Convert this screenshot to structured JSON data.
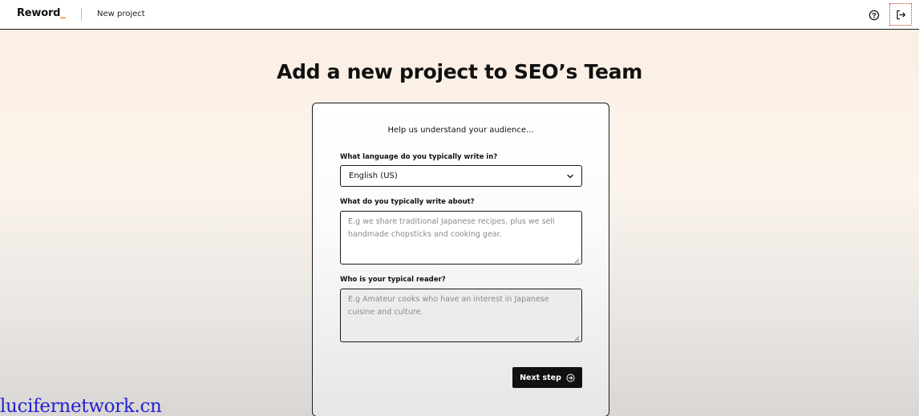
{
  "header": {
    "logo_text": "Reword",
    "logo_accent": "_",
    "breadcrumb": "New project",
    "icons": {
      "help": "help-circle-icon",
      "logout": "logout-icon"
    }
  },
  "page": {
    "title": "Add a new project to SEO’s Team"
  },
  "form": {
    "heading": "Help us understand your audience...",
    "language": {
      "label": "What language do you typically write in?",
      "selected": "English (US)"
    },
    "topic": {
      "label": "What do you typically write about?",
      "placeholder": "E.g we share traditional Japanese recipes, plus we sell handmade chopsticks and cooking gear."
    },
    "reader": {
      "label": "Who is your typical reader?",
      "placeholder": "E.g Amateur cooks who have an interest in Japanese cuisine and culture."
    },
    "next_button": "Next step"
  },
  "watermark": "lucifernetwork.cn",
  "colors": {
    "accent": "#f07a12",
    "button": "#111111",
    "watermark": "#2323d6"
  }
}
